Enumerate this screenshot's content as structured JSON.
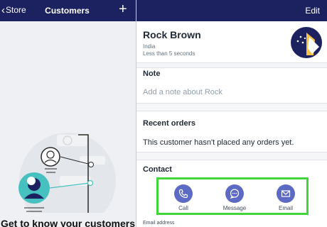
{
  "left_panel": {
    "back_label": "Store",
    "title": "Customers",
    "add_label": "+",
    "empty_state_heading": "Get to know your customers"
  },
  "right_panel": {
    "edit_label": "Edit",
    "customer": {
      "name": "Rock Brown",
      "location": "India",
      "last_seen": "Less than 5 seconds"
    },
    "note": {
      "title": "Note",
      "placeholder": "Add a note about Rock"
    },
    "recent_orders": {
      "title": "Recent orders",
      "empty_text": "This customer hasn't placed any orders yet."
    },
    "contact": {
      "title": "Contact",
      "actions": [
        {
          "label": "Call",
          "icon": "phone-icon"
        },
        {
          "label": "Message",
          "icon": "chat-bubble-icon"
        },
        {
          "label": "Email",
          "icon": "envelope-icon"
        }
      ],
      "email_field_label": "Email address"
    }
  },
  "colors": {
    "nav_bar": "#1c2260",
    "action_circle": "#5c6ac4",
    "highlight_border": "#41d639",
    "illustration_teal": "#47c1bf"
  }
}
